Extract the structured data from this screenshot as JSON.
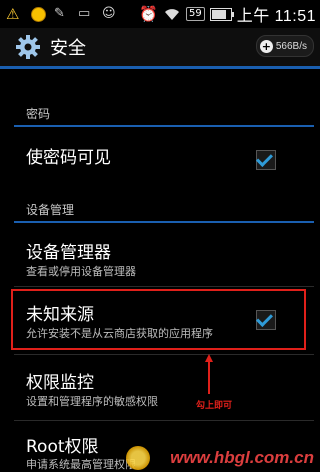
{
  "statusbar": {
    "sim_label": "59",
    "time": "上午 11:51"
  },
  "actionbar": {
    "title": "安全",
    "speed": "566B/s"
  },
  "sections": {
    "password_header": "密码",
    "device_admin_header": "设备管理"
  },
  "items": {
    "show_password": {
      "title": "使密码可见",
      "checked": true
    },
    "device_admins": {
      "title": "设备管理器",
      "subtitle": "查看或停用设备管理器"
    },
    "unknown_sources": {
      "title": "未知来源",
      "subtitle": "允许安装不是从云商店获取的应用程序",
      "checked": true
    },
    "permission_monitor": {
      "title": "权限监控",
      "subtitle": "设置和管理程序的敏感权限"
    },
    "root_permission": {
      "title": "Root权限",
      "subtitle": "申请系统最高管理权限"
    }
  },
  "annotation": {
    "text": "勾上即可"
  },
  "watermark": {
    "text": "www.hbgl.com.cn"
  },
  "colors": {
    "accent": "#1a5fb0",
    "checkmark": "#2f9bd8",
    "highlight": "#e0201a"
  }
}
